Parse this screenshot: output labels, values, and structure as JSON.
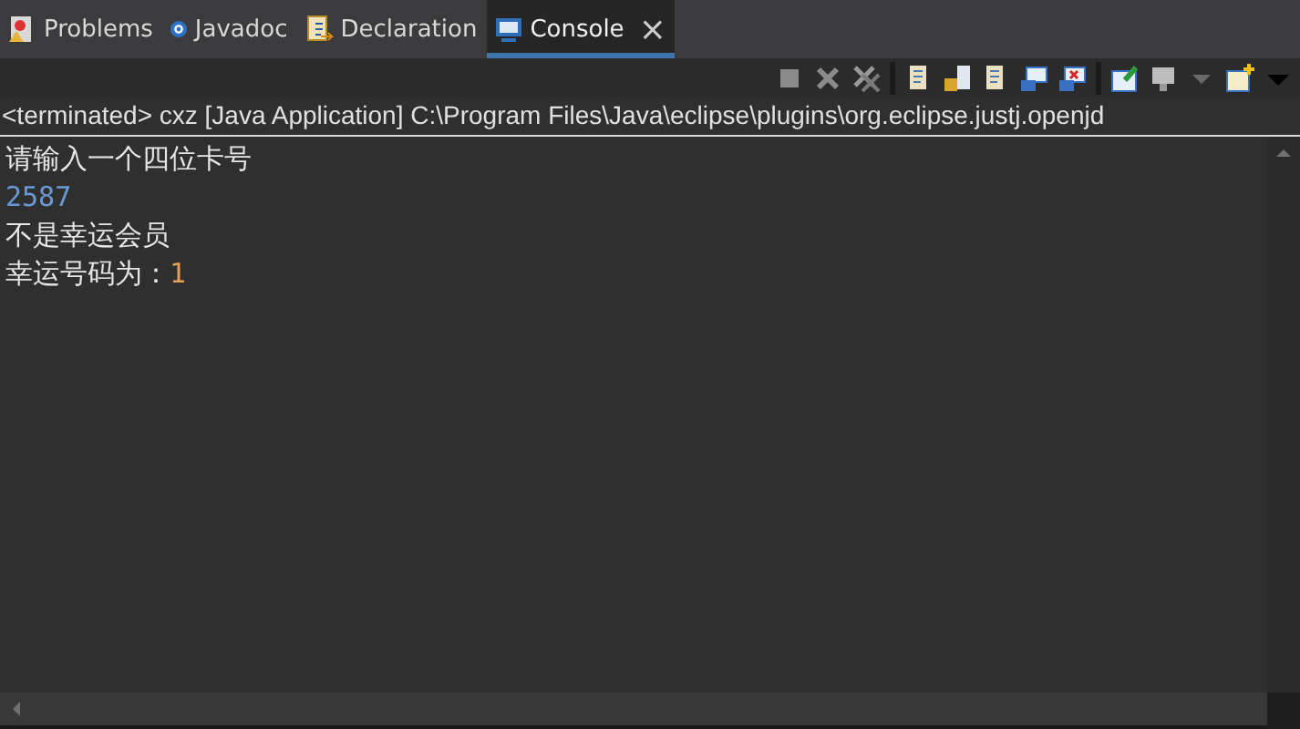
{
  "tabs": [
    {
      "label": "Problems",
      "selected": false
    },
    {
      "label": "Javadoc",
      "selected": false
    },
    {
      "label": "Declaration",
      "selected": false
    },
    {
      "label": "Console",
      "selected": true
    }
  ],
  "close_glyph": "×",
  "status_line": "<terminated> cxz [Java Application] C:\\Program Files\\Java\\eclipse\\plugins\\org.eclipse.justj.openjd",
  "console_lines": [
    [
      {
        "text": "请输入一个四位卡号",
        "kind": "output"
      }
    ],
    [
      {
        "text": "2587",
        "kind": "input"
      }
    ],
    [
      {
        "text": "不是幸运会员",
        "kind": "output"
      }
    ],
    [
      {
        "text": "幸运号码为：",
        "kind": "output"
      },
      {
        "text": "1",
        "kind": "number"
      }
    ]
  ]
}
